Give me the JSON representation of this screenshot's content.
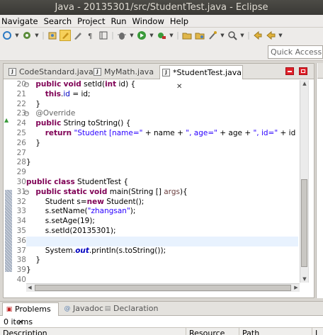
{
  "window": {
    "title": "Java - 20135301/src/StudentTest.java - Eclipse"
  },
  "menu": [
    "Navigate",
    "Search",
    "Project",
    "Run",
    "Window",
    "Help"
  ],
  "toolbar": {
    "icons": [
      "sync-icon",
      "chevron-down-icon",
      "gear-run-icon",
      "chevron-down-icon",
      "new-java-project-icon",
      "highlight-icon",
      "pen-icon",
      "show-whitespace-icon",
      "block-select-icon",
      "debug-icon",
      "chevron-down-icon",
      "run-icon",
      "chevron-down-icon",
      "external-tools-icon",
      "chevron-down-icon",
      "open-folder-icon",
      "open-type-icon",
      "open-task-icon",
      "chevron-down-icon",
      "search-icon",
      "chevron-down-icon",
      "prev-annotation-icon",
      "back-icon",
      "chevron-down-icon"
    ]
  },
  "quick_access": {
    "placeholder": "Quick Access"
  },
  "editor": {
    "tabs": [
      {
        "label": "CodeStandard.java"
      },
      {
        "label": "MyMath.java"
      },
      {
        "label": "*StudentTest.java",
        "close": "✕"
      }
    ],
    "line_numbers": [
      "20",
      "21",
      "22",
      "23",
      "24",
      "25",
      "26",
      "27",
      "28",
      "29",
      "30",
      "31",
      "32",
      "33",
      "34",
      "35",
      "36",
      "37",
      "38",
      "39",
      "40"
    ],
    "code_lines": [
      "    public void setId(int id) {",
      "        this.id = id;",
      "    }",
      "    @Override",
      "    public String toString() {",
      "        return \"Student [name=\" + name + \", age=\" + age + \", id=\" + id + \"]\";",
      "    }",
      "",
      "}",
      "",
      "public class StudentTest {",
      "    public static void main(String [] args){",
      "        Student s=new Student();",
      "        s.setName(\"zhangsan\");",
      "        s.setAge(19);",
      "        s.setId(20135301);",
      "",
      "        System.out.println(s.toString());",
      "    }",
      "}",
      ""
    ]
  },
  "bottom_panel": {
    "tabs": [
      {
        "label": "Problems",
        "close": "✕"
      },
      {
        "label": "Javadoc"
      },
      {
        "label": "Declaration"
      }
    ],
    "status": "0 items",
    "columns": [
      "Description",
      "Resource",
      "Path",
      "L"
    ]
  }
}
